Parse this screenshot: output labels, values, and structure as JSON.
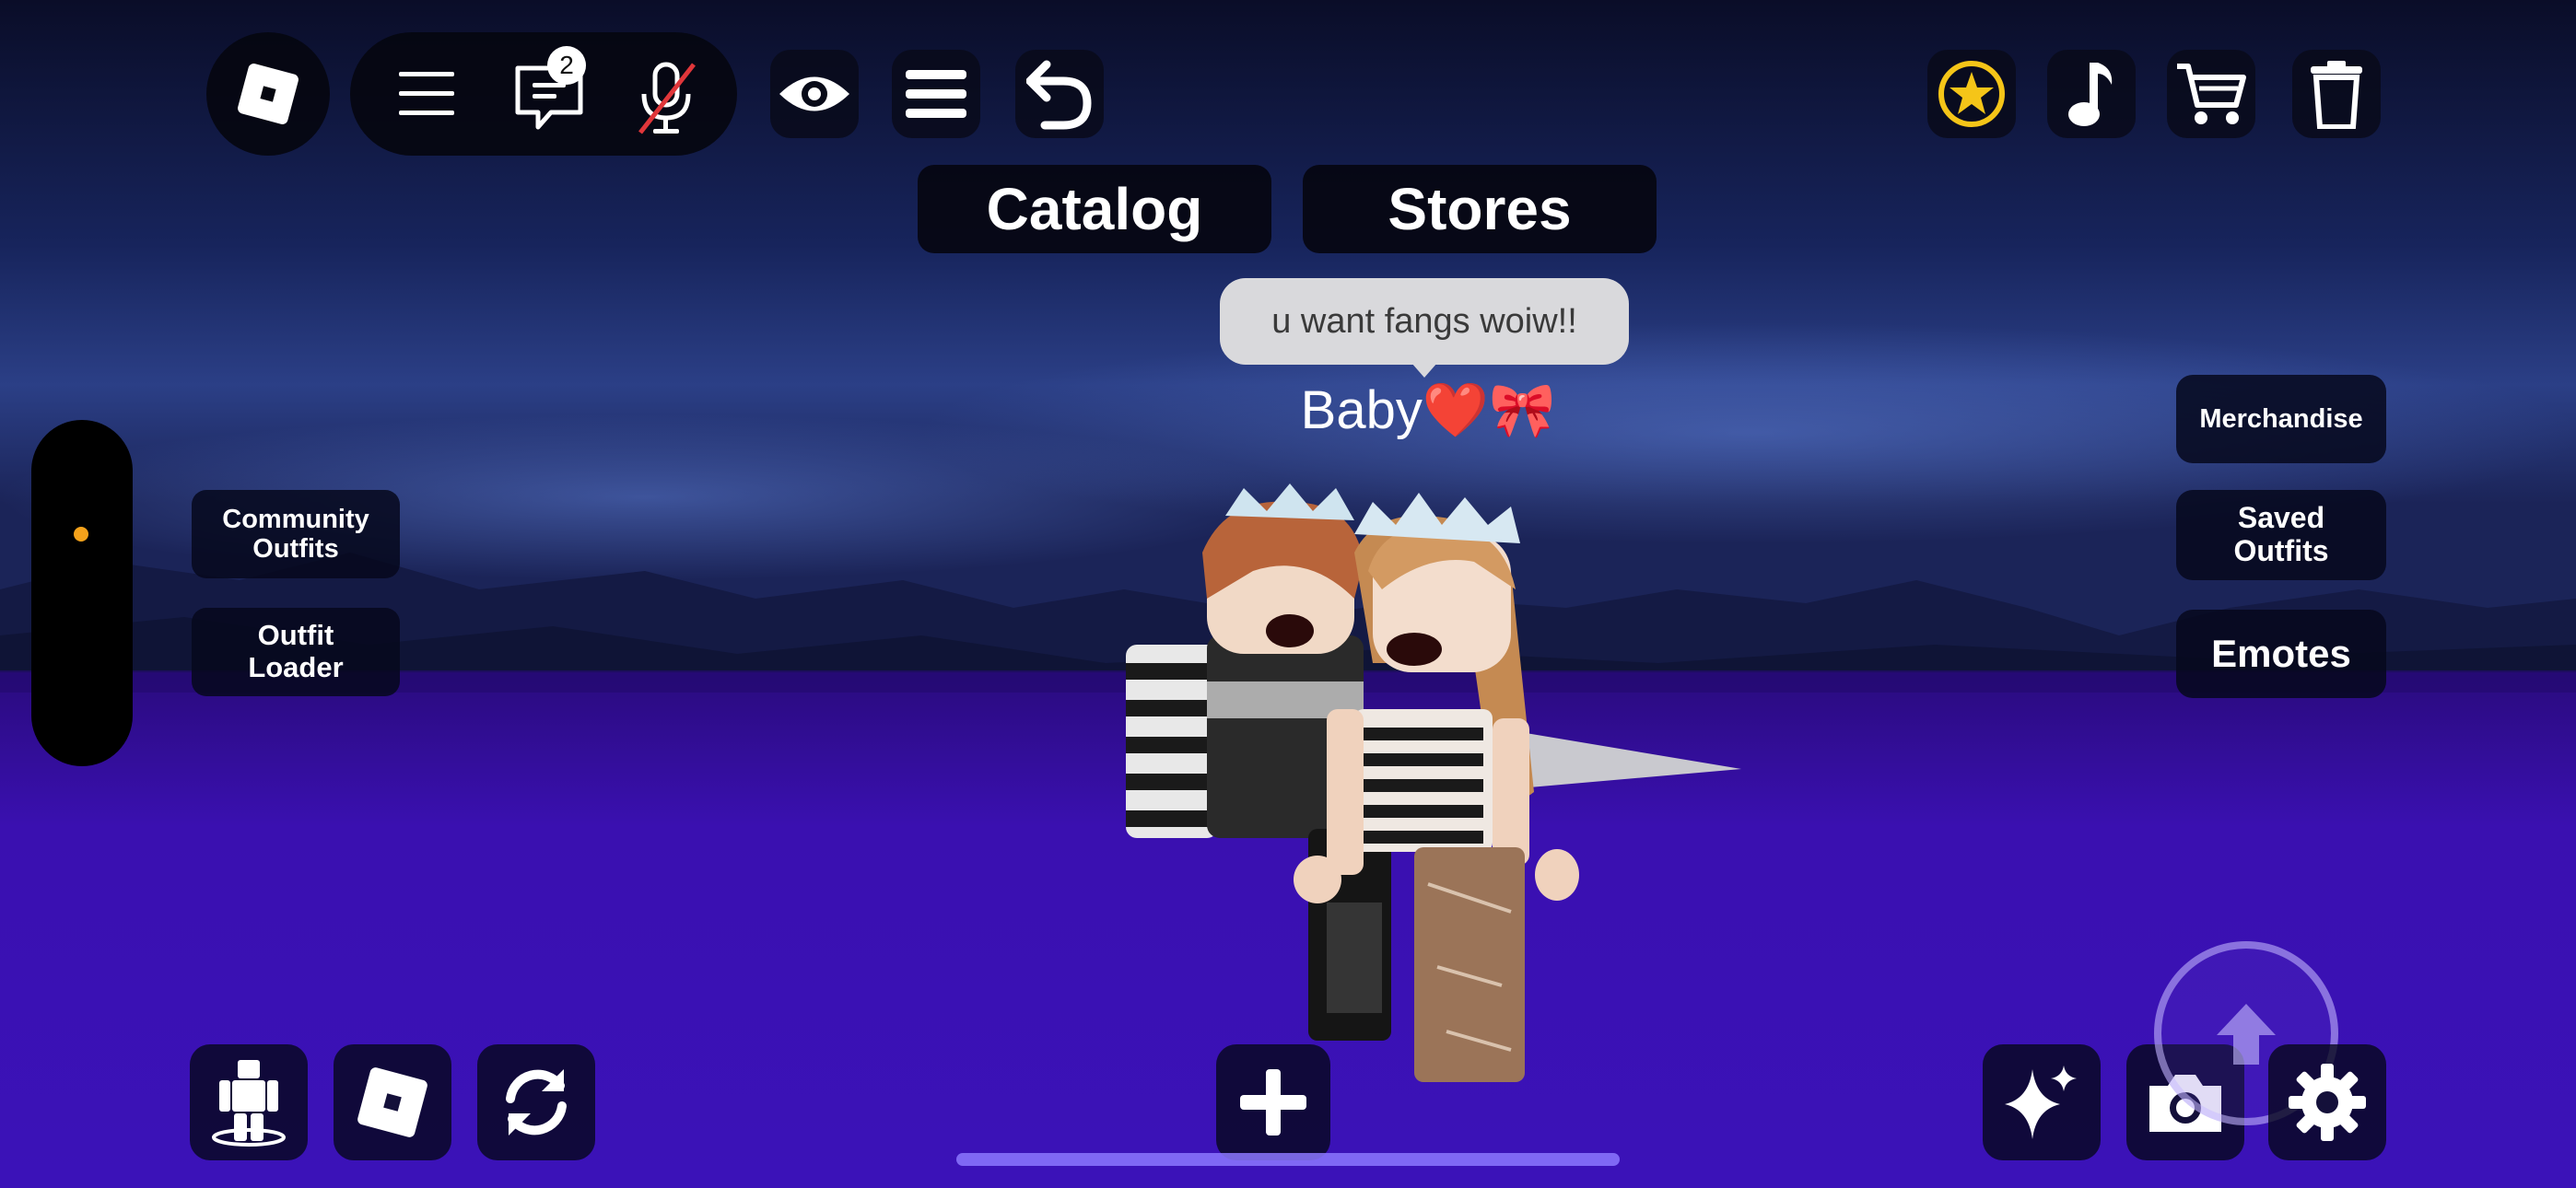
{
  "app": {
    "name": "Roblox"
  },
  "topbar": {
    "roblox_menu_icon": "roblox-logo-icon",
    "hamburger_icon": "hamburger-icon",
    "chat_icon": "chat-icon",
    "chat_badge_count": "2",
    "mic_icon": "mic-muted-icon",
    "eye_icon": "eye-icon",
    "list_icon": "list-menu-icon",
    "undo_icon": "undo-icon"
  },
  "top_right": {
    "items": [
      "vip-star-icon",
      "music-note-icon",
      "cart-icon",
      "trash-icon"
    ],
    "star_color": "#f5c518"
  },
  "tabs": {
    "catalog_label": "Catalog",
    "stores_label": "Stores"
  },
  "chat": {
    "bubble_text": "u want fangs woiw!!",
    "player_name": "Baby❤️🎀"
  },
  "left_panel": {
    "community_outfits": "Community Outfits",
    "outfit_loader": "Outfit Loader",
    "slider_dot_color": "#f5a21b"
  },
  "right_panel": {
    "merchandise": "Merchandise",
    "saved_outfits": "Saved Outfits",
    "emotes": "Emotes"
  },
  "bottom_bar": {
    "left_icons": [
      "avatar-body-icon",
      "roblox-logo-icon",
      "refresh-icon"
    ],
    "center_icon": "plus-icon",
    "right_icons": [
      "sparkles-icon",
      "camera-icon",
      "gear-icon"
    ],
    "jump_icon": "jump-arrow-icon"
  },
  "colors": {
    "sky_top": "#0d1030",
    "sky_mid": "#23347a",
    "ground": "#3a0fb4",
    "ground_dark": "#2c0a8c",
    "button_bg": "#080a18"
  }
}
